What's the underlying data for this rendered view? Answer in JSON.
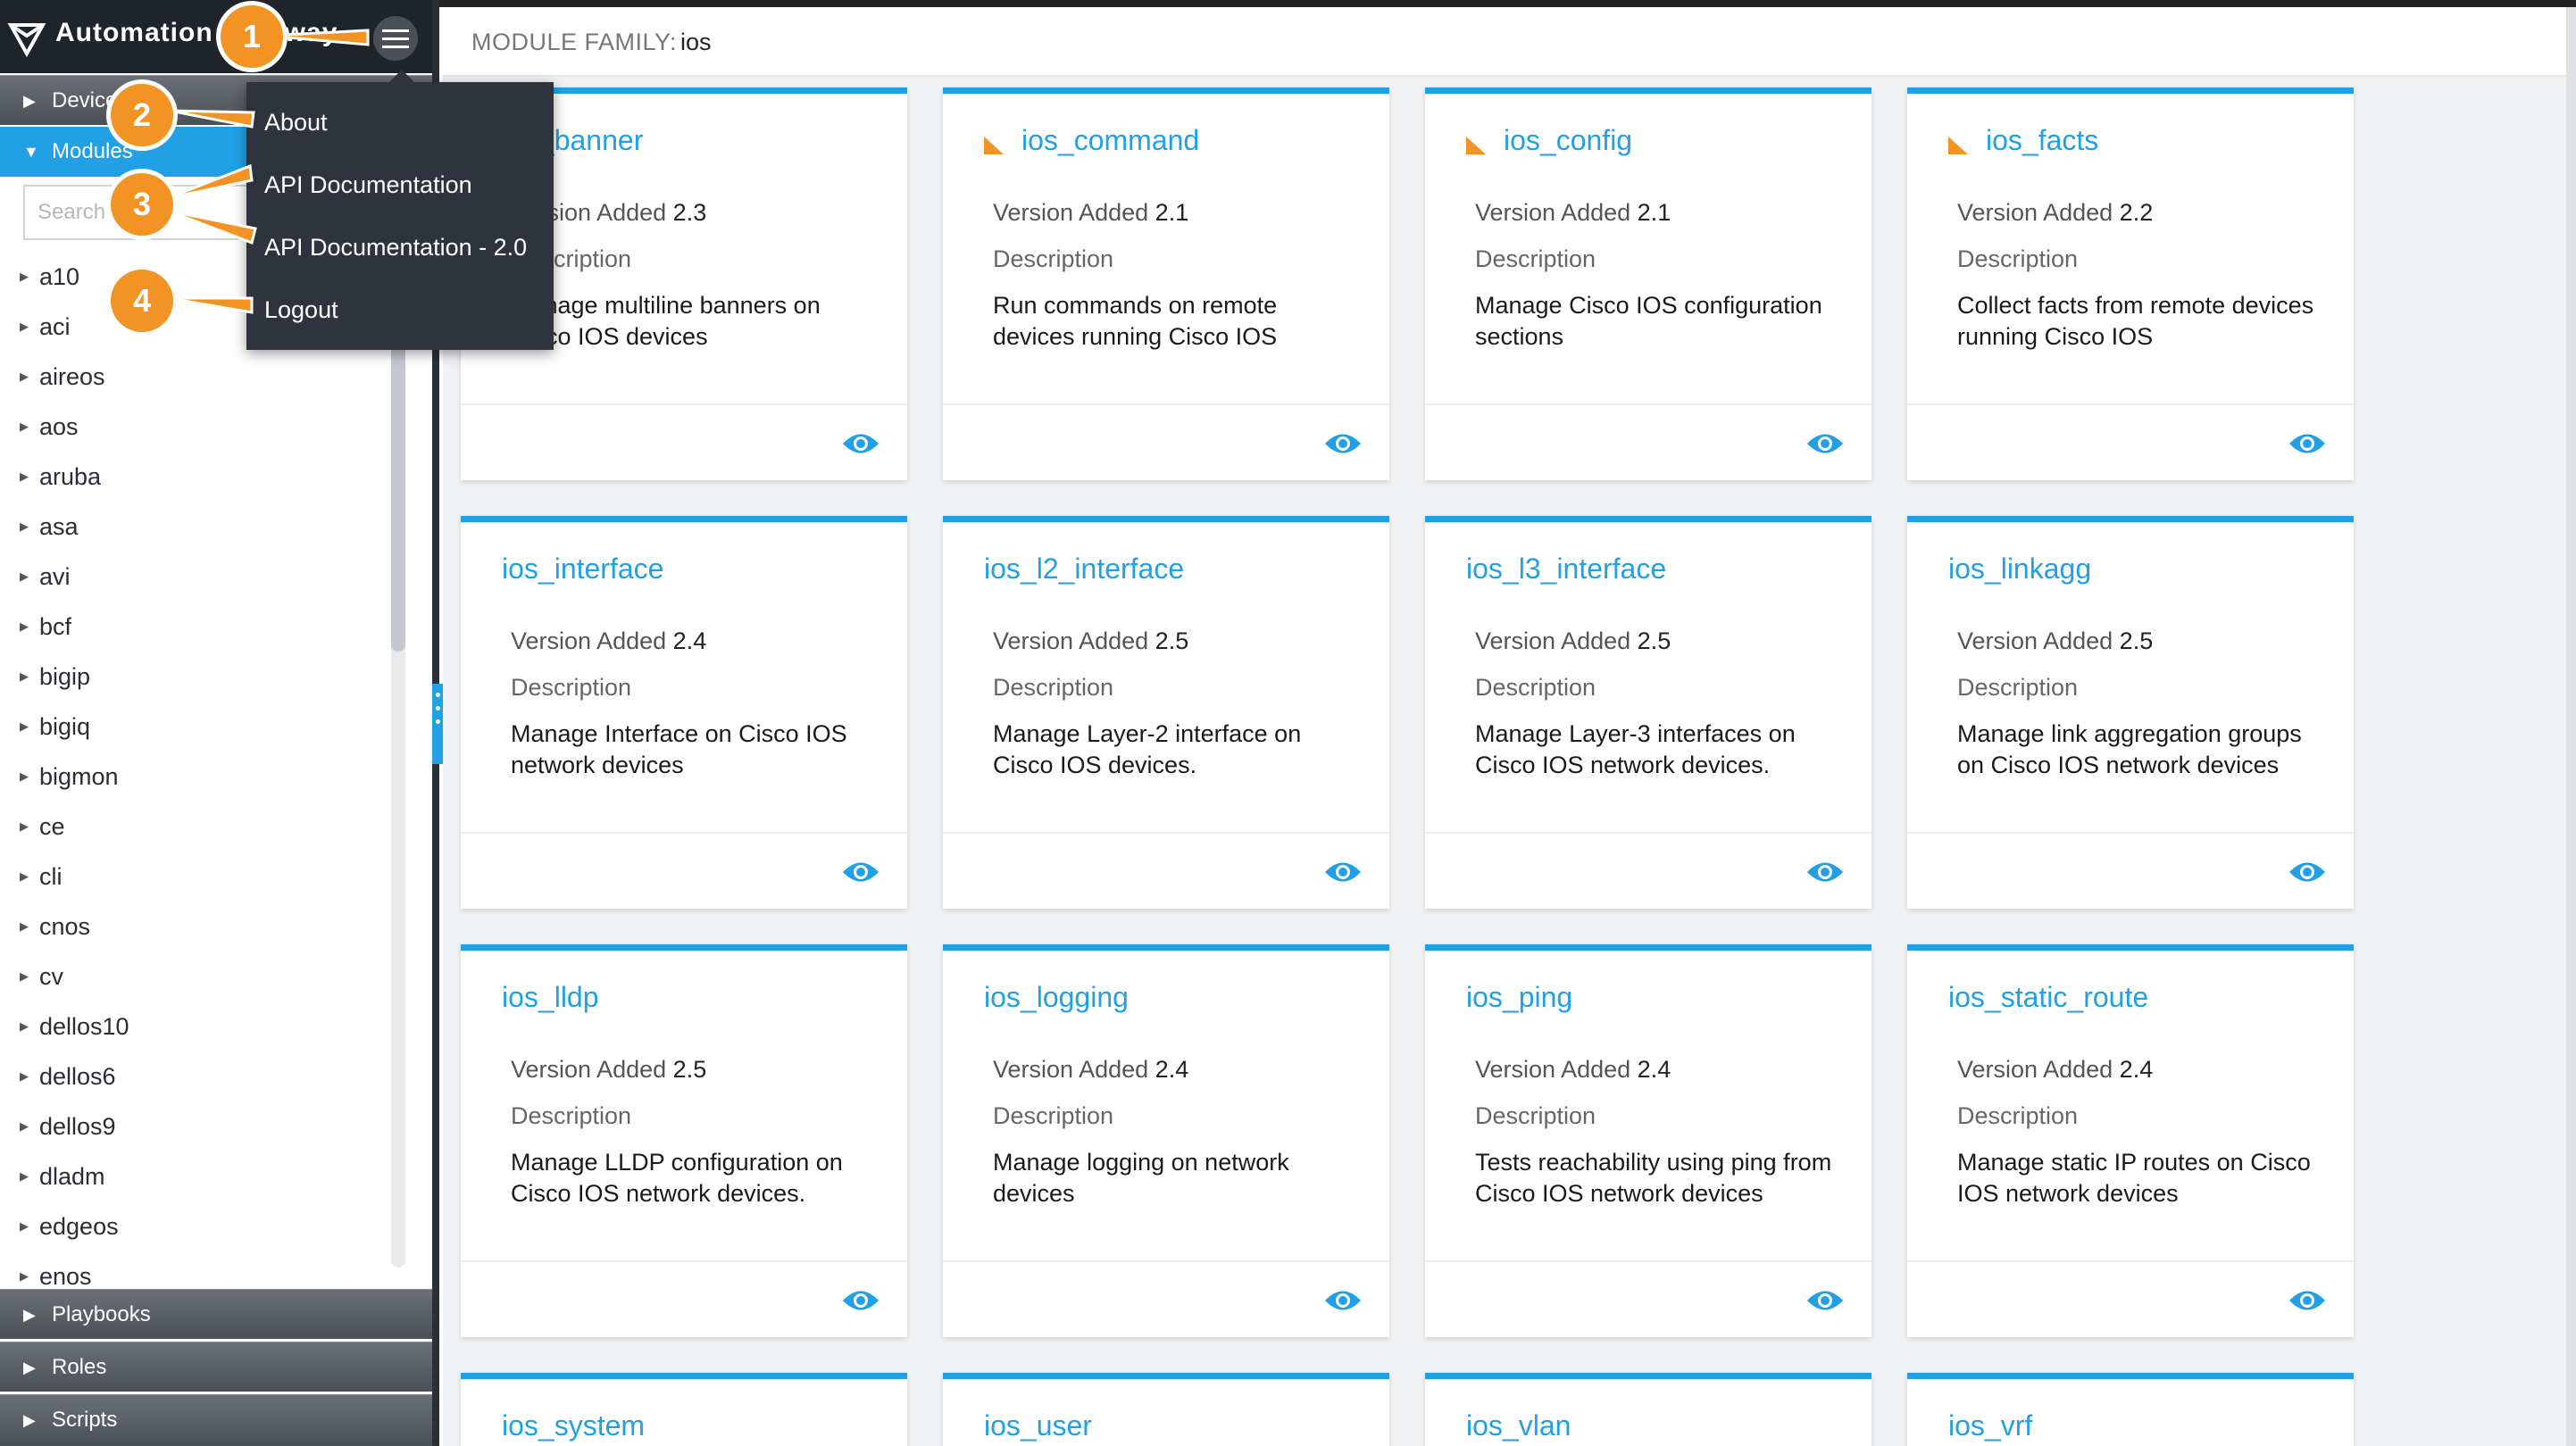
{
  "app": {
    "title": "Automation Gateway"
  },
  "sidebar": {
    "sections": {
      "devices": "Devices",
      "modules": "Modules",
      "playbooks": "Playbooks",
      "roles": "Roles",
      "scripts": "Scripts"
    },
    "search_placeholder": "Search",
    "module_families": [
      "a10",
      "aci",
      "aireos",
      "aos",
      "aruba",
      "asa",
      "avi",
      "bcf",
      "bigip",
      "bigiq",
      "bigmon",
      "ce",
      "cli",
      "cnos",
      "cv",
      "dellos10",
      "dellos6",
      "dellos9",
      "dladm",
      "edgeos",
      "enos"
    ]
  },
  "menu": {
    "items": [
      "About",
      "API Documentation",
      "API Documentation - 2.0",
      "Logout"
    ]
  },
  "callouts": [
    "1",
    "2",
    "3",
    "4"
  ],
  "header": {
    "label": "MODULE FAMILY:",
    "value": "ios"
  },
  "cards": [
    {
      "name": "ios_banner",
      "version_label": "Version Added",
      "version": "2.3",
      "desc_label": "Description",
      "desc": "Manage multiline banners on Cisco IOS devices"
    },
    {
      "name": "ios_command",
      "version_label": "Version Added",
      "version": "2.1",
      "desc_label": "Description",
      "desc": "Run commands on remote devices running Cisco IOS"
    },
    {
      "name": "ios_config",
      "version_label": "Version Added",
      "version": "2.1",
      "desc_label": "Description",
      "desc": "Manage Cisco IOS configuration sections"
    },
    {
      "name": "ios_facts",
      "version_label": "Version Added",
      "version": "2.2",
      "desc_label": "Description",
      "desc": "Collect facts from remote devices running Cisco IOS"
    },
    {
      "name": "ios_interface",
      "version_label": "Version Added",
      "version": "2.4",
      "desc_label": "Description",
      "desc": "Manage Interface on Cisco IOS network devices"
    },
    {
      "name": "ios_l2_interface",
      "version_label": "Version Added",
      "version": "2.5",
      "desc_label": "Description",
      "desc": "Manage Layer-2 interface on Cisco IOS devices."
    },
    {
      "name": "ios_l3_interface",
      "version_label": "Version Added",
      "version": "2.5",
      "desc_label": "Description",
      "desc": "Manage Layer-3 interfaces on Cisco IOS network devices."
    },
    {
      "name": "ios_linkagg",
      "version_label": "Version Added",
      "version": "2.5",
      "desc_label": "Description",
      "desc": "Manage link aggregation groups on Cisco IOS network devices"
    },
    {
      "name": "ios_lldp",
      "version_label": "Version Added",
      "version": "2.5",
      "desc_label": "Description",
      "desc": "Manage LLDP configuration on Cisco IOS network devices."
    },
    {
      "name": "ios_logging",
      "version_label": "Version Added",
      "version": "2.4",
      "desc_label": "Description",
      "desc": "Manage logging on network devices"
    },
    {
      "name": "ios_ping",
      "version_label": "Version Added",
      "version": "2.4",
      "desc_label": "Description",
      "desc": "Tests reachability using ping from Cisco IOS network devices"
    },
    {
      "name": "ios_static_route",
      "version_label": "Version Added",
      "version": "2.4",
      "desc_label": "Description",
      "desc": "Manage static IP routes on Cisco IOS network devices"
    },
    {
      "name": "ios_system"
    },
    {
      "name": "ios_user"
    },
    {
      "name": "ios_vlan"
    },
    {
      "name": "ios_vrf"
    }
  ],
  "colors": {
    "accent": "#21a0e6",
    "callout": "#f39323",
    "sidebar_dark": "#1f232a"
  }
}
